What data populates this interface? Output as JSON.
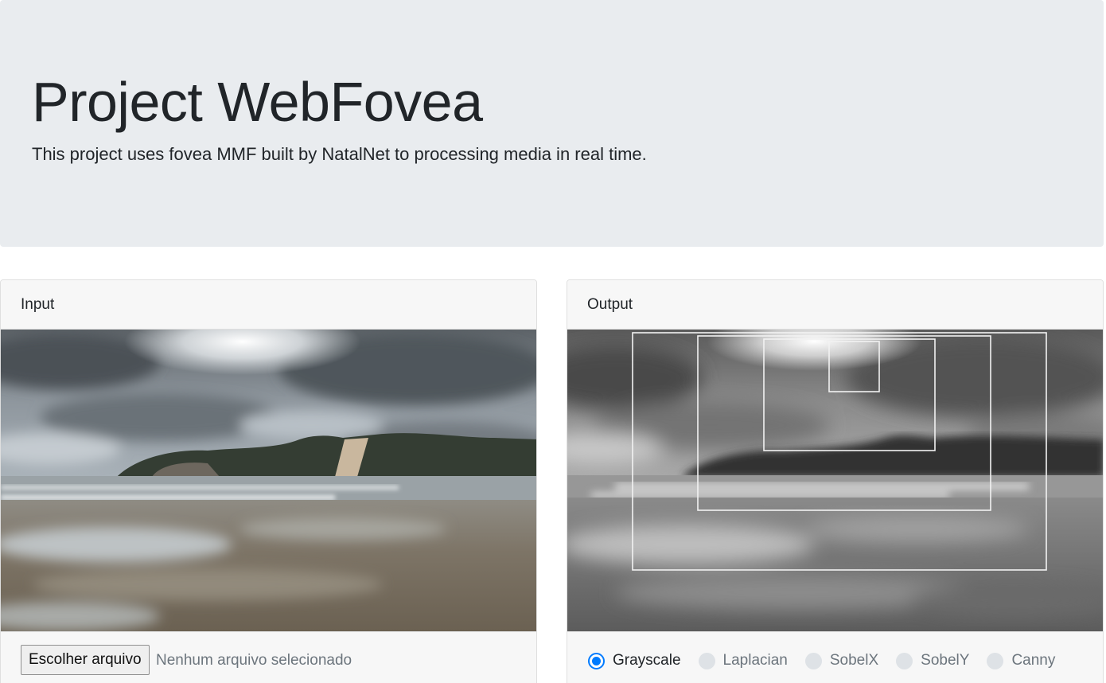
{
  "jumbotron": {
    "title": "Project WebFovea",
    "subtitle": "This project uses fovea MMF built by NatalNet to processing media in real time."
  },
  "input_card": {
    "header": "Input",
    "file_button": "Escolher arquivo",
    "file_status": "Nenhum arquivo selecionado"
  },
  "output_card": {
    "header": "Output",
    "filters": [
      {
        "label": "Grayscale",
        "checked": true
      },
      {
        "label": "Laplacian",
        "checked": false
      },
      {
        "label": "SobelX",
        "checked": false
      },
      {
        "label": "SobelY",
        "checked": false
      },
      {
        "label": "Canny",
        "checked": false
      }
    ]
  },
  "colors": {
    "jumbotron_bg": "#e9ecef",
    "accent": "#007bff",
    "card_header_bg": "#f7f7f7"
  }
}
